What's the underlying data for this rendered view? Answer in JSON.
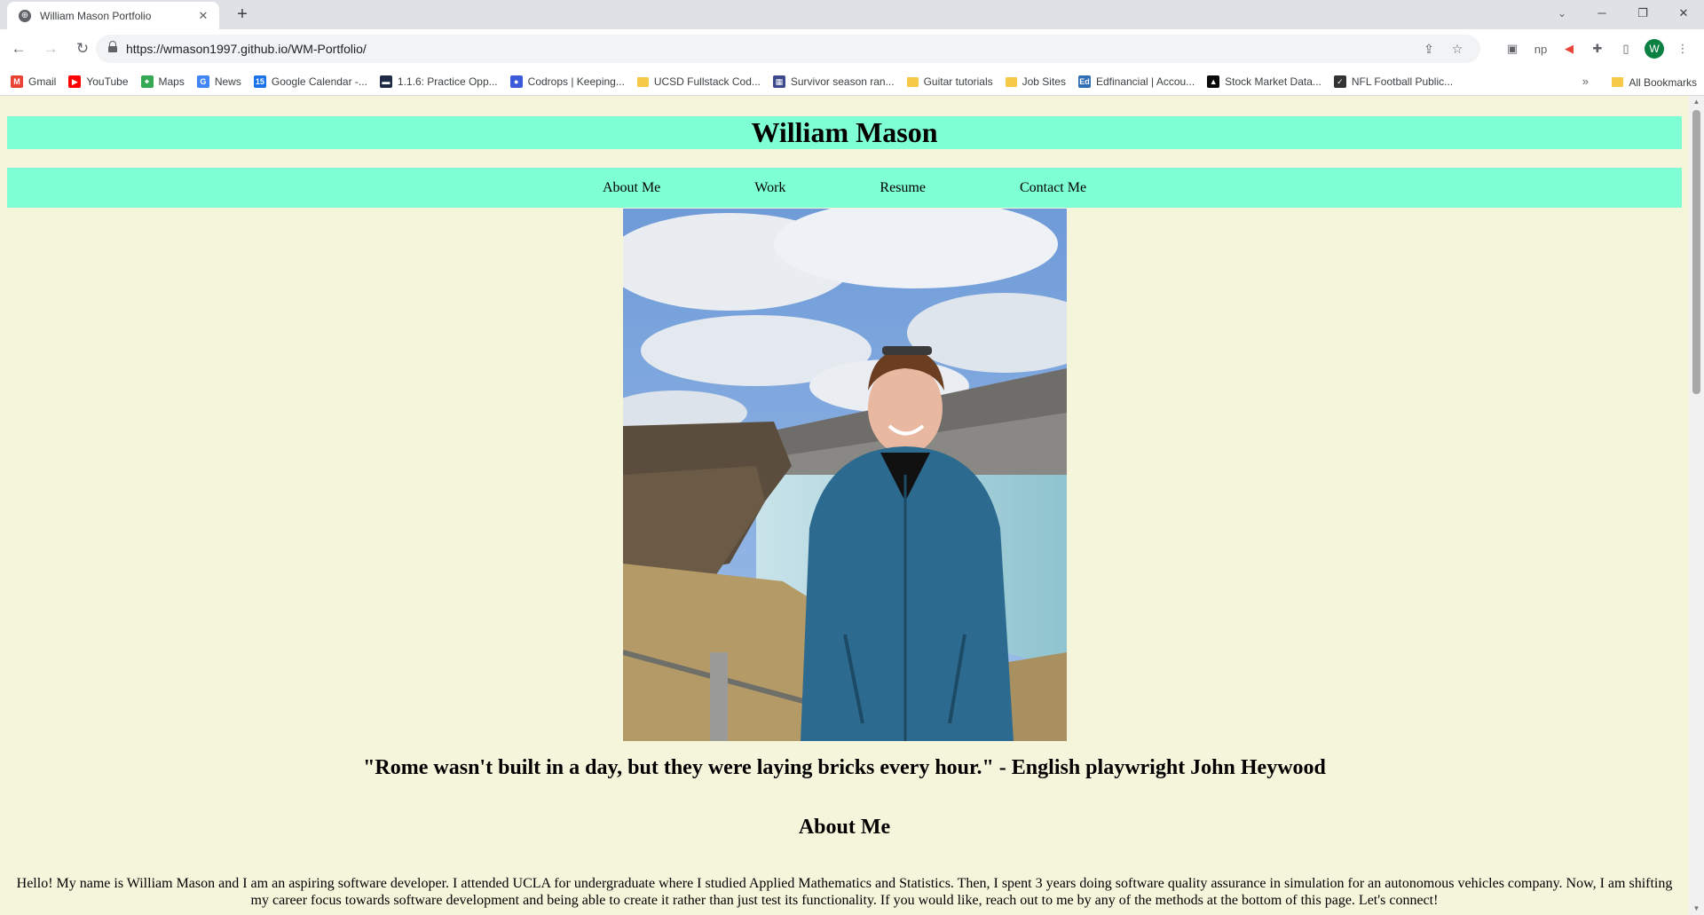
{
  "browser": {
    "tab_title": "William Mason Portfolio",
    "url": "https://wmason1997.github.io/WM-Portfolio/",
    "profile_initial": "W",
    "bookmarks": [
      {
        "label": "Gmail",
        "icon": "gmail-icon",
        "color": "#ea4335",
        "glyph": "M"
      },
      {
        "label": "YouTube",
        "icon": "youtube-icon",
        "color": "#ff0000",
        "glyph": "▶"
      },
      {
        "label": "Maps",
        "icon": "maps-icon",
        "color": "#34a853",
        "glyph": "⌖"
      },
      {
        "label": "News",
        "icon": "news-icon",
        "color": "#4285f4",
        "glyph": "G"
      },
      {
        "label": "Google Calendar -...",
        "icon": "calendar-icon",
        "color": "#1a73e8",
        "glyph": "15"
      },
      {
        "label": "1.1.6: Practice Opp...",
        "icon": "practice-icon",
        "color": "#1f2a44",
        "glyph": "▬"
      },
      {
        "label": "Codrops | Keeping...",
        "icon": "codrops-icon",
        "color": "#3b5bdb",
        "glyph": "●"
      },
      {
        "label": "UCSD Fullstack Cod...",
        "icon": "folder-icon",
        "color": "#f7c948",
        "glyph": ""
      },
      {
        "label": "Survivor season ran...",
        "icon": "table-icon",
        "color": "#3c4a8c",
        "glyph": "▦"
      },
      {
        "label": "Guitar tutorials",
        "icon": "folder-icon",
        "color": "#f7c948",
        "glyph": ""
      },
      {
        "label": "Job Sites",
        "icon": "folder-icon",
        "color": "#f7c948",
        "glyph": ""
      },
      {
        "label": "Edfinancial | Accou...",
        "icon": "edfinancial-icon",
        "color": "#2f6db5",
        "glyph": "Ed"
      },
      {
        "label": "Stock Market Data...",
        "icon": "stock-icon",
        "color": "#0a0a0a",
        "glyph": "▲"
      },
      {
        "label": "NFL Football Public...",
        "icon": "nfl-icon",
        "color": "#333333",
        "glyph": "✓"
      }
    ],
    "all_bookmarks_label": "All Bookmarks"
  },
  "site": {
    "title": "William Mason",
    "nav": [
      "About Me",
      "Work",
      "Resume",
      "Contact Me"
    ],
    "quote": "\"Rome wasn't built in a day, but they were laying bricks every hour.\" - English playwright John Heywood",
    "about_heading": "About Me",
    "about_text": "Hello! My name is William Mason and I am an aspiring software developer. I attended UCLA for undergraduate where I studied Applied Mathematics and Statistics. Then, I spent 3 years doing software quality assurance in simulation for an autonomous vehicles company. Now, I am shifting my career focus towards software development and being able to create it rather than just test its functionality. If you would like, reach out to me by any of the methods at the bottom of this page. Let's connect!"
  },
  "colors": {
    "page_background": "#f5f5dc",
    "header_background": "#7fffd4"
  }
}
